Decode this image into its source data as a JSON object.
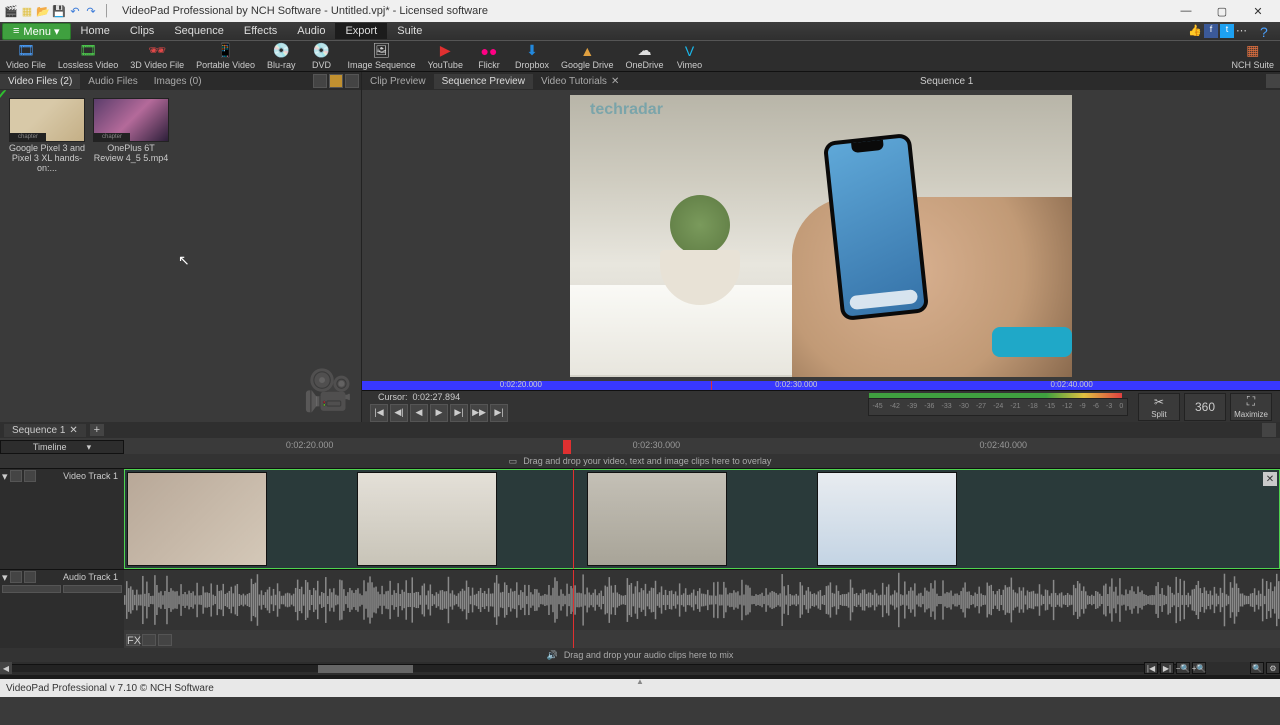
{
  "app": {
    "title": "VideoPad Professional by NCH Software - Untitled.vpj* - Licensed software",
    "status": "VideoPad Professional v 7.10 © NCH Software"
  },
  "qat_icons": [
    "app-icon",
    "new-icon",
    "open-icon",
    "save-icon",
    "undo-icon",
    "redo-icon"
  ],
  "window_buttons": {
    "min": "—",
    "max": "▢",
    "close": "✕"
  },
  "menu": {
    "button": "Menu ▾",
    "items": [
      "Home",
      "Clips",
      "Sequence",
      "Effects",
      "Audio",
      "Export",
      "Suite"
    ],
    "active": "Export"
  },
  "social_icons": [
    "thumb-up-icon",
    "facebook-icon",
    "twitter-icon",
    "share-icon"
  ],
  "ribbon": [
    {
      "icon": "🎞",
      "label": "Video File",
      "c": "#4aa0ff"
    },
    {
      "icon": "🎞",
      "label": "Lossless Video",
      "c": "#4fd44f"
    },
    {
      "icon": "🕶",
      "label": "3D Video File",
      "c": "#e04848"
    },
    {
      "icon": "📱",
      "label": "Portable Video",
      "c": "#aaa"
    },
    {
      "icon": "💿",
      "label": "Blu-ray",
      "c": "#4aa0ff"
    },
    {
      "icon": "💿",
      "label": "DVD",
      "c": "#e0a040"
    },
    {
      "icon": "🖼",
      "label": "Image Sequence",
      "c": "#ccc"
    },
    {
      "icon": "▶",
      "label": "YouTube",
      "c": "#e03030"
    },
    {
      "icon": "●●",
      "label": "Flickr",
      "c": "#ff0084"
    },
    {
      "icon": "⬇",
      "label": "Dropbox",
      "c": "#2288dd"
    },
    {
      "icon": "▲",
      "label": "Google Drive",
      "c": "#e0a040"
    },
    {
      "icon": "☁",
      "label": "OneDrive",
      "c": "#ddd"
    },
    {
      "icon": "V",
      "label": "Vimeo",
      "c": "#1ab7ea"
    }
  ],
  "ribbon_suite": {
    "icon": "▦",
    "label": "NCH Suite"
  },
  "bin": {
    "tabs": [
      "Video Files",
      "Audio Files",
      "Images"
    ],
    "counts": [
      "(2)",
      "",
      "(0)"
    ],
    "active": 0,
    "clips": [
      {
        "name": "Google Pixel 3 and Pixel 3 XL hands-on:...",
        "checked": true
      },
      {
        "name": "OnePlus 6T Review  4_5 5.mp4",
        "checked": false
      }
    ]
  },
  "preview": {
    "tabs": [
      "Clip Preview",
      "Sequence Preview",
      "Video Tutorials"
    ],
    "active": 1,
    "sequence_name": "Sequence 1",
    "watermark": "techradar",
    "timeline_marks": [
      "0:02:20.000",
      "0:02:30.000",
      "0:02:40.000"
    ],
    "cursor_label": "Cursor:",
    "cursor_time": "0:02:27.894",
    "ruler_db": [
      "-45",
      "-42",
      "-39",
      "-36",
      "-33",
      "-30",
      "-27",
      "-24",
      "-21",
      "-18",
      "-15",
      "-12",
      "-9",
      "-6",
      "-3",
      "0"
    ],
    "right_buttons": [
      {
        "icon": "✂",
        "label": "Split"
      },
      {
        "icon": "360",
        "label": ""
      },
      {
        "icon": "⛶",
        "label": "Maximize"
      }
    ]
  },
  "seqtabs": {
    "name": "Sequence 1"
  },
  "timeline": {
    "selector": "Timeline",
    "ruler": [
      "0:02:20.000",
      "0:02:30.000",
      "0:02:40.000"
    ],
    "playhead_pct": 38,
    "overlay_hint": "Drag and drop your video, text and image clips here to overlay",
    "mix_hint": "Drag and drop your audio clips here to mix",
    "video_track": "Video Track 1",
    "audio_track": "Audio Track 1"
  },
  "transport_icons": [
    "|◀",
    "◀|",
    "◀",
    "▶",
    "▶|",
    "▶▶",
    "▶|"
  ]
}
